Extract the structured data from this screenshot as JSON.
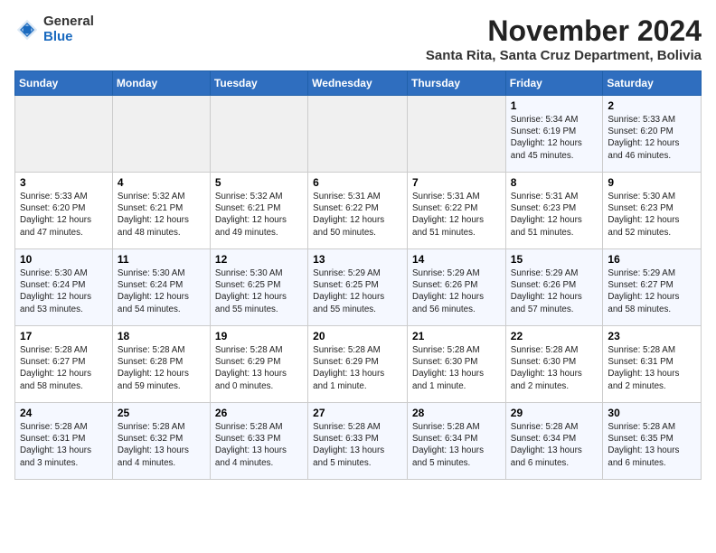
{
  "logo": {
    "general": "General",
    "blue": "Blue"
  },
  "header": {
    "month": "November 2024",
    "location": "Santa Rita, Santa Cruz Department, Bolivia"
  },
  "weekdays": [
    "Sunday",
    "Monday",
    "Tuesday",
    "Wednesday",
    "Thursday",
    "Friday",
    "Saturday"
  ],
  "weeks": [
    [
      {
        "day": "",
        "info": ""
      },
      {
        "day": "",
        "info": ""
      },
      {
        "day": "",
        "info": ""
      },
      {
        "day": "",
        "info": ""
      },
      {
        "day": "",
        "info": ""
      },
      {
        "day": "1",
        "info": "Sunrise: 5:34 AM\nSunset: 6:19 PM\nDaylight: 12 hours\nand 45 minutes."
      },
      {
        "day": "2",
        "info": "Sunrise: 5:33 AM\nSunset: 6:20 PM\nDaylight: 12 hours\nand 46 minutes."
      }
    ],
    [
      {
        "day": "3",
        "info": "Sunrise: 5:33 AM\nSunset: 6:20 PM\nDaylight: 12 hours\nand 47 minutes."
      },
      {
        "day": "4",
        "info": "Sunrise: 5:32 AM\nSunset: 6:21 PM\nDaylight: 12 hours\nand 48 minutes."
      },
      {
        "day": "5",
        "info": "Sunrise: 5:32 AM\nSunset: 6:21 PM\nDaylight: 12 hours\nand 49 minutes."
      },
      {
        "day": "6",
        "info": "Sunrise: 5:31 AM\nSunset: 6:22 PM\nDaylight: 12 hours\nand 50 minutes."
      },
      {
        "day": "7",
        "info": "Sunrise: 5:31 AM\nSunset: 6:22 PM\nDaylight: 12 hours\nand 51 minutes."
      },
      {
        "day": "8",
        "info": "Sunrise: 5:31 AM\nSunset: 6:23 PM\nDaylight: 12 hours\nand 51 minutes."
      },
      {
        "day": "9",
        "info": "Sunrise: 5:30 AM\nSunset: 6:23 PM\nDaylight: 12 hours\nand 52 minutes."
      }
    ],
    [
      {
        "day": "10",
        "info": "Sunrise: 5:30 AM\nSunset: 6:24 PM\nDaylight: 12 hours\nand 53 minutes."
      },
      {
        "day": "11",
        "info": "Sunrise: 5:30 AM\nSunset: 6:24 PM\nDaylight: 12 hours\nand 54 minutes."
      },
      {
        "day": "12",
        "info": "Sunrise: 5:30 AM\nSunset: 6:25 PM\nDaylight: 12 hours\nand 55 minutes."
      },
      {
        "day": "13",
        "info": "Sunrise: 5:29 AM\nSunset: 6:25 PM\nDaylight: 12 hours\nand 55 minutes."
      },
      {
        "day": "14",
        "info": "Sunrise: 5:29 AM\nSunset: 6:26 PM\nDaylight: 12 hours\nand 56 minutes."
      },
      {
        "day": "15",
        "info": "Sunrise: 5:29 AM\nSunset: 6:26 PM\nDaylight: 12 hours\nand 57 minutes."
      },
      {
        "day": "16",
        "info": "Sunrise: 5:29 AM\nSunset: 6:27 PM\nDaylight: 12 hours\nand 58 minutes."
      }
    ],
    [
      {
        "day": "17",
        "info": "Sunrise: 5:28 AM\nSunset: 6:27 PM\nDaylight: 12 hours\nand 58 minutes."
      },
      {
        "day": "18",
        "info": "Sunrise: 5:28 AM\nSunset: 6:28 PM\nDaylight: 12 hours\nand 59 minutes."
      },
      {
        "day": "19",
        "info": "Sunrise: 5:28 AM\nSunset: 6:29 PM\nDaylight: 13 hours\nand 0 minutes."
      },
      {
        "day": "20",
        "info": "Sunrise: 5:28 AM\nSunset: 6:29 PM\nDaylight: 13 hours\nand 1 minute."
      },
      {
        "day": "21",
        "info": "Sunrise: 5:28 AM\nSunset: 6:30 PM\nDaylight: 13 hours\nand 1 minute."
      },
      {
        "day": "22",
        "info": "Sunrise: 5:28 AM\nSunset: 6:30 PM\nDaylight: 13 hours\nand 2 minutes."
      },
      {
        "day": "23",
        "info": "Sunrise: 5:28 AM\nSunset: 6:31 PM\nDaylight: 13 hours\nand 2 minutes."
      }
    ],
    [
      {
        "day": "24",
        "info": "Sunrise: 5:28 AM\nSunset: 6:31 PM\nDaylight: 13 hours\nand 3 minutes."
      },
      {
        "day": "25",
        "info": "Sunrise: 5:28 AM\nSunset: 6:32 PM\nDaylight: 13 hours\nand 4 minutes."
      },
      {
        "day": "26",
        "info": "Sunrise: 5:28 AM\nSunset: 6:33 PM\nDaylight: 13 hours\nand 4 minutes."
      },
      {
        "day": "27",
        "info": "Sunrise: 5:28 AM\nSunset: 6:33 PM\nDaylight: 13 hours\nand 5 minutes."
      },
      {
        "day": "28",
        "info": "Sunrise: 5:28 AM\nSunset: 6:34 PM\nDaylight: 13 hours\nand 5 minutes."
      },
      {
        "day": "29",
        "info": "Sunrise: 5:28 AM\nSunset: 6:34 PM\nDaylight: 13 hours\nand 6 minutes."
      },
      {
        "day": "30",
        "info": "Sunrise: 5:28 AM\nSunset: 6:35 PM\nDaylight: 13 hours\nand 6 minutes."
      }
    ]
  ]
}
